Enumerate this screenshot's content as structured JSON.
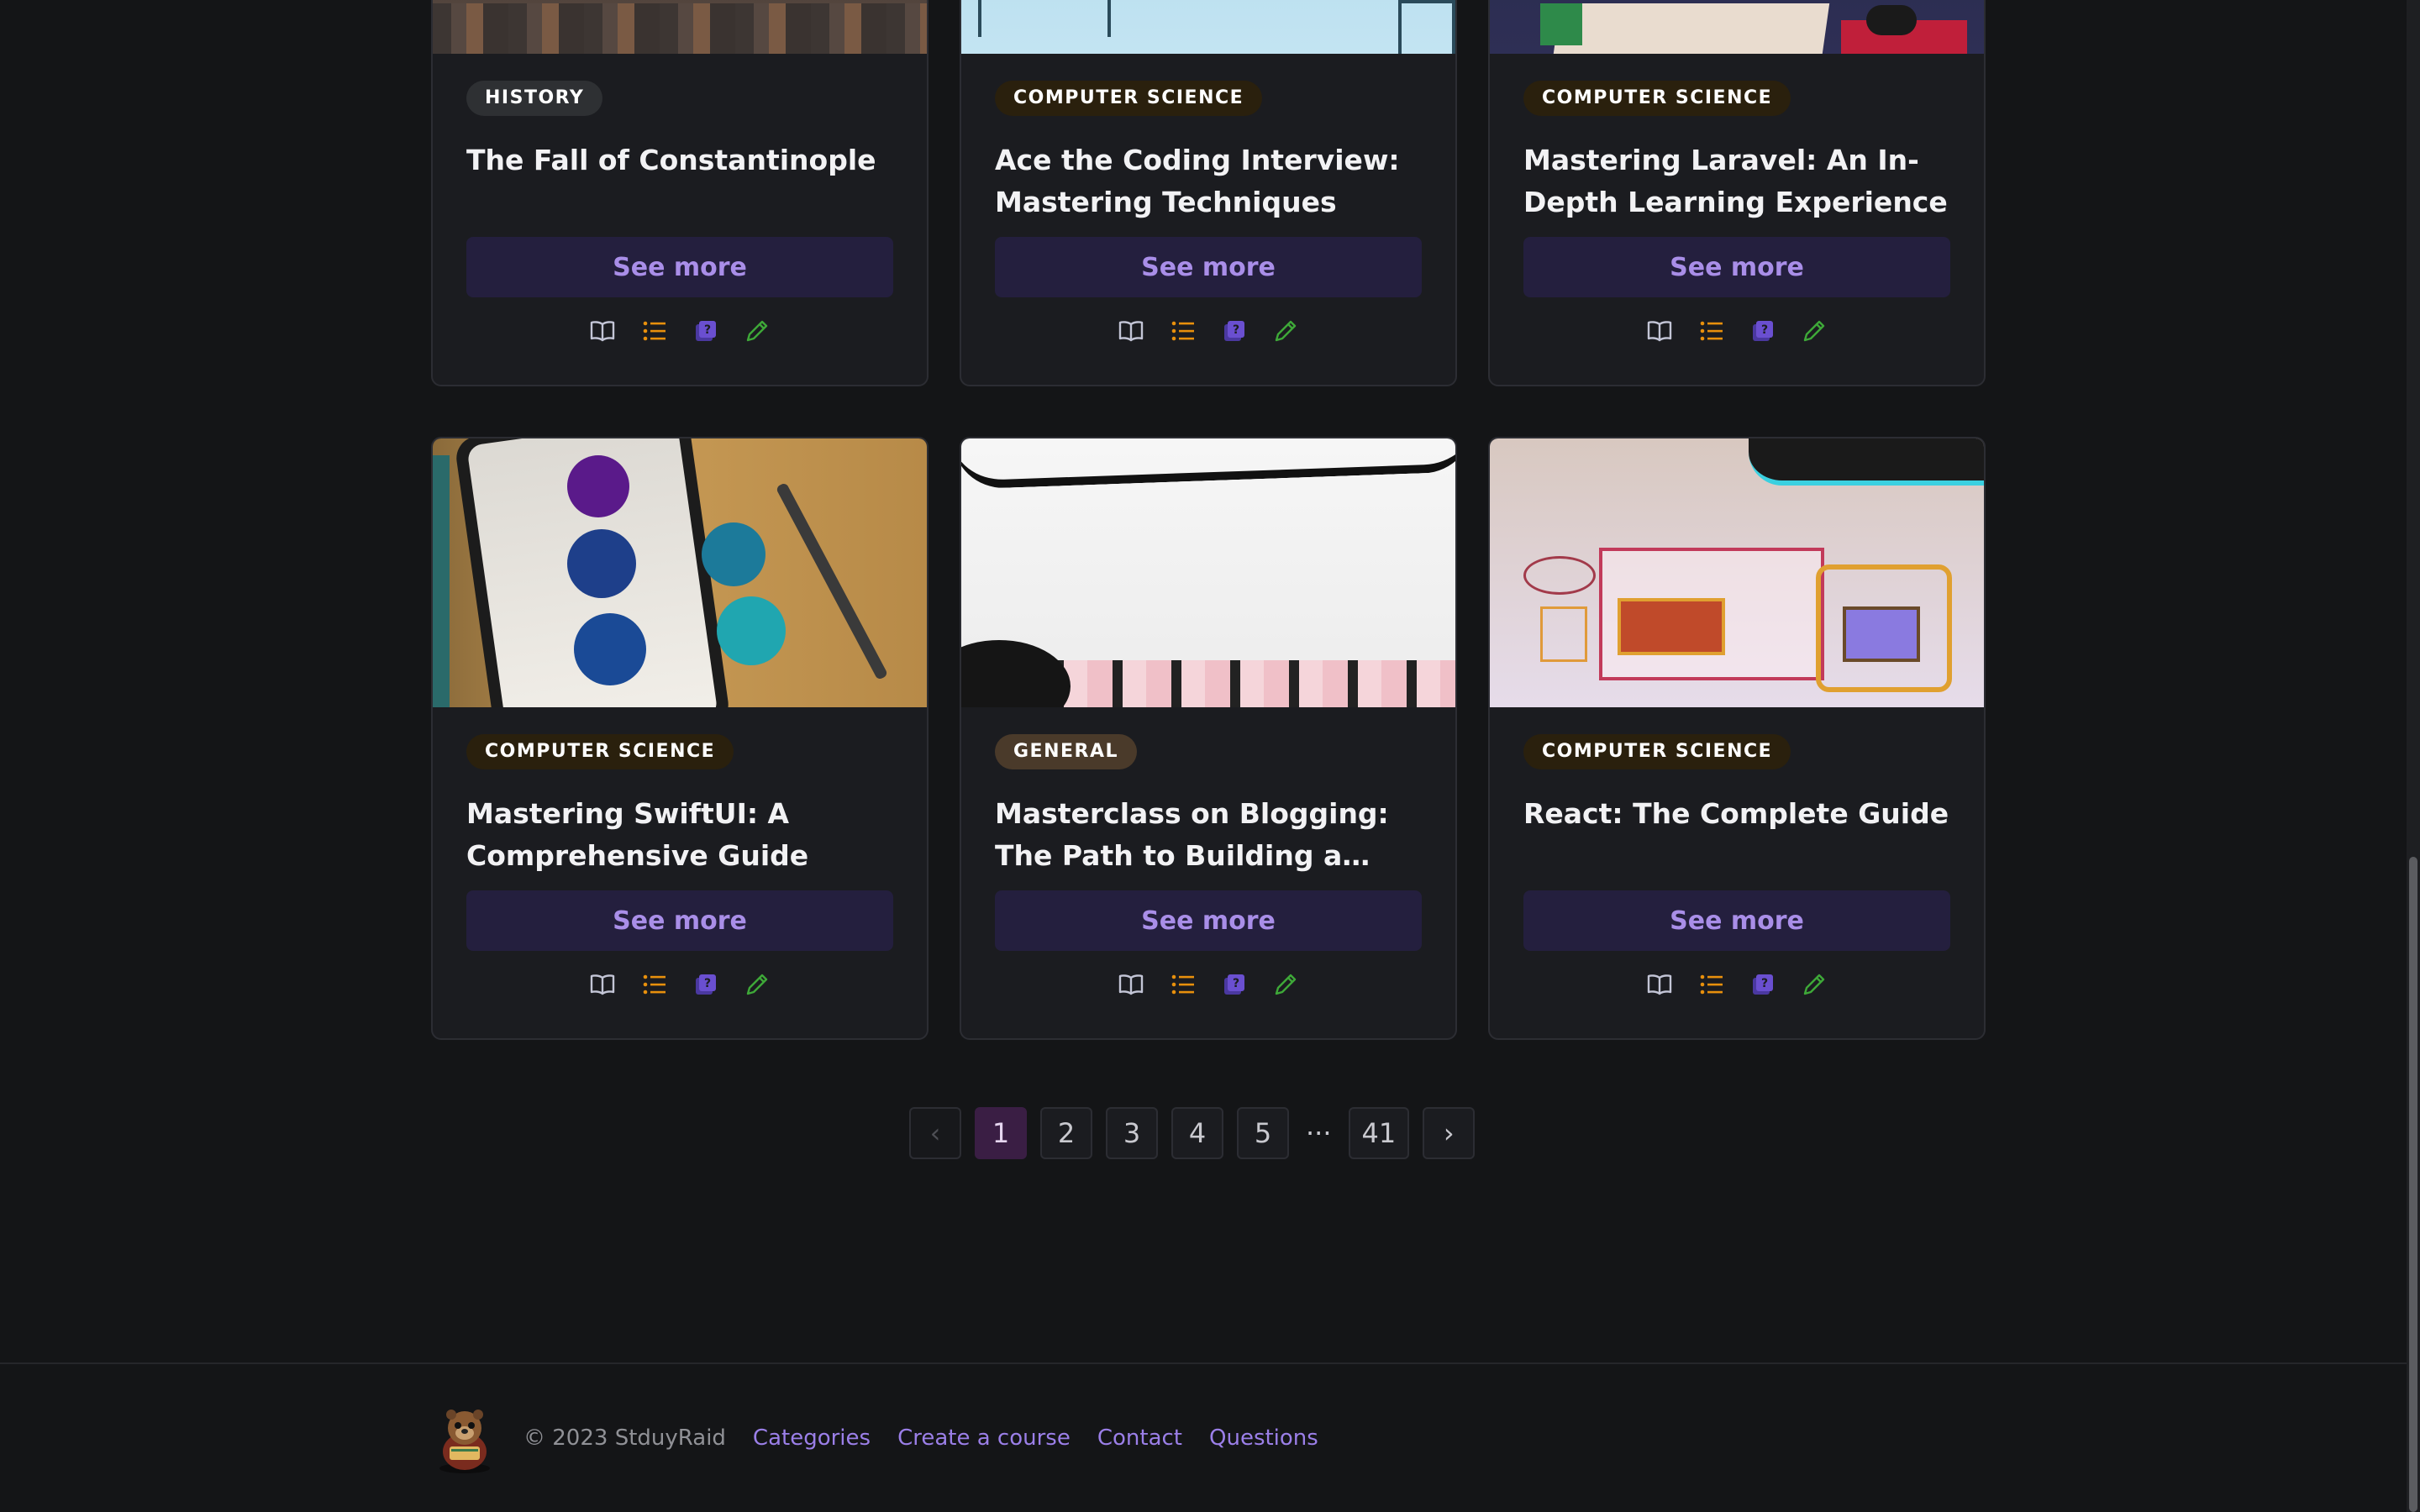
{
  "cards": [
    {
      "category": "HISTORY",
      "title": "The Fall of Constantinople",
      "button": "See more"
    },
    {
      "category": "COMPUTER SCIENCE",
      "title": "Ace the Coding Interview: Mastering Techniques and…",
      "button": "See more"
    },
    {
      "category": "COMPUTER SCIENCE",
      "title": "Mastering Laravel: An In-Depth Learning Experience",
      "button": "See more"
    },
    {
      "category": "COMPUTER SCIENCE",
      "title": "Mastering SwiftUI: A Comprehensive Guide",
      "button": "See more"
    },
    {
      "category": "GENERAL",
      "title": "Masterclass on Blogging: The Path to Building a…",
      "button": "See more"
    },
    {
      "category": "COMPUTER SCIENCE",
      "title": "React: The Complete Guide",
      "button": "See more"
    }
  ],
  "card_icons": [
    "book-icon",
    "list-icon",
    "quiz-book-icon",
    "pencil-icon"
  ],
  "pagination": {
    "prev": "‹",
    "pages": [
      "1",
      "2",
      "3",
      "4",
      "5"
    ],
    "current": "1",
    "ellipsis": "···",
    "last": "41",
    "next": "›"
  },
  "footer": {
    "copyright": "© 2023 StduyRaid",
    "links": [
      "Categories",
      "Create a course",
      "Contact",
      "Questions"
    ]
  },
  "colors": {
    "background": "#141517",
    "card": "#1b1c20",
    "button_bg": "#241f3e",
    "button_text": "#a98ee8",
    "active_page": "#3a1e44",
    "link": "#9b7fe8",
    "icon_book": "#c3c5d6",
    "icon_list": "#e8900c",
    "icon_quiz": "#6a4fd0",
    "icon_pencil": "#3ea838"
  }
}
